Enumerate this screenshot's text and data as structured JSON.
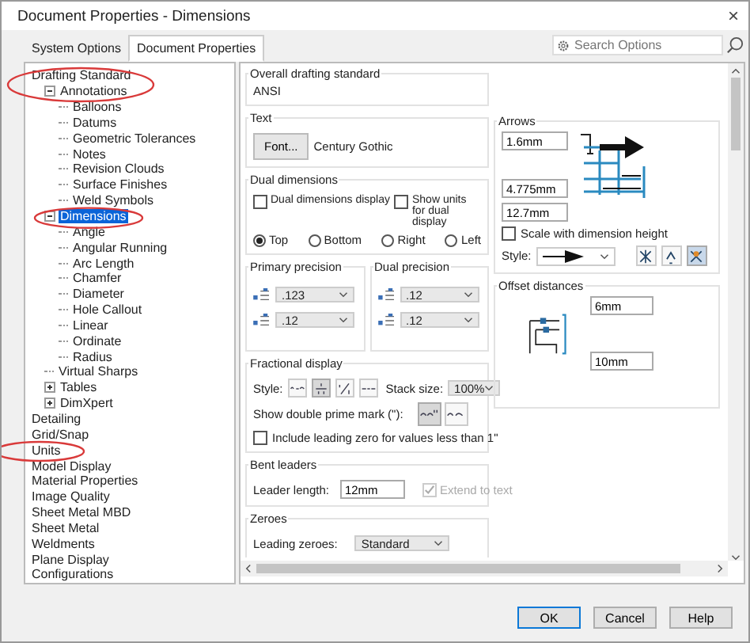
{
  "window": {
    "title": "Document Properties - Dimensions",
    "close": "×"
  },
  "tabs": [
    {
      "label": "System Options",
      "selected": false
    },
    {
      "label": "Document Properties",
      "selected": true
    }
  ],
  "search": {
    "placeholder": "Search Options"
  },
  "tree": [
    {
      "label": "Drafting Standard",
      "selected": false,
      "children": [
        {
          "label": "Annotations",
          "selected": false,
          "expanded": true,
          "children": [
            {
              "label": "Balloons",
              "selected": false
            },
            {
              "label": "Datums",
              "selected": false
            },
            {
              "label": "Geometric Tolerances",
              "selected": false
            },
            {
              "label": "Notes",
              "selected": false
            },
            {
              "label": "Revision Clouds",
              "selected": false
            },
            {
              "label": "Surface Finishes",
              "selected": false
            },
            {
              "label": "Weld Symbols",
              "selected": false
            }
          ]
        },
        {
          "label": "Dimensions",
          "selected": true,
          "expanded": true,
          "children": [
            {
              "label": "Angle",
              "selected": false
            },
            {
              "label": "Angular Running",
              "selected": false
            },
            {
              "label": "Arc Length",
              "selected": false
            },
            {
              "label": "Chamfer",
              "selected": false
            },
            {
              "label": "Diameter",
              "selected": false
            },
            {
              "label": "Hole Callout",
              "selected": false
            },
            {
              "label": "Linear",
              "selected": false
            },
            {
              "label": "Ordinate",
              "selected": false
            },
            {
              "label": "Radius",
              "selected": false
            }
          ]
        },
        {
          "label": "Virtual Sharps",
          "selected": false
        },
        {
          "label": "Tables",
          "selected": false,
          "expanded": false
        },
        {
          "label": "DimXpert",
          "selected": false,
          "expanded": false
        }
      ]
    },
    {
      "label": "Detailing",
      "selected": false
    },
    {
      "label": "Grid/Snap",
      "selected": false
    },
    {
      "label": "Units",
      "selected": false
    },
    {
      "label": "Model Display",
      "selected": false
    },
    {
      "label": "Material Properties",
      "selected": false
    },
    {
      "label": "Image Quality",
      "selected": false
    },
    {
      "label": "Sheet Metal MBD",
      "selected": false
    },
    {
      "label": "Sheet Metal",
      "selected": false
    },
    {
      "label": "Weldments",
      "selected": false
    },
    {
      "label": "Plane Display",
      "selected": false
    },
    {
      "label": "Configurations",
      "selected": false
    }
  ],
  "overall": {
    "title": "Overall drafting standard",
    "value": "ANSI"
  },
  "text_section": {
    "title": "Text",
    "button": "Font...",
    "font": "Century Gothic"
  },
  "dual": {
    "title": "Dual dimensions",
    "checkboxes": [
      {
        "label": "Dual dimensions display",
        "checked": false
      },
      {
        "label": "Show units for dual display",
        "checked": false
      }
    ],
    "positions": [
      {
        "label": "Top",
        "selected": true
      },
      {
        "label": "Bottom",
        "selected": false
      },
      {
        "label": "Right",
        "selected": false
      },
      {
        "label": "Left",
        "selected": false
      }
    ]
  },
  "primary_precision": {
    "title": "Primary precision",
    "values": [
      ".123",
      ".12"
    ]
  },
  "dual_precision": {
    "title": "Dual precision",
    "values": [
      ".12",
      ".12"
    ]
  },
  "fractional": {
    "title": "Fractional display",
    "style_label": "Style:",
    "styles": [
      {
        "kind": "inline",
        "selected": false
      },
      {
        "kind": "stacked",
        "selected": true
      },
      {
        "kind": "diagonal",
        "selected": false
      },
      {
        "kind": "spaced",
        "selected": false
      }
    ],
    "stack_label": "Stack size:",
    "stack_value": "100%",
    "prime_label": "Show double prime mark (\"):",
    "prime_options": [
      {
        "kind": "with-prime",
        "selected": true
      },
      {
        "kind": "plain",
        "selected": false
      }
    ],
    "leading_zero": {
      "label": "Include leading zero for values less than 1\"",
      "checked": false
    }
  },
  "bent": {
    "title": "Bent leaders",
    "length_label": "Leader length:",
    "length_value": "12mm",
    "extend": {
      "label": "Extend to text",
      "checked": true,
      "disabled": true
    }
  },
  "zeroes": {
    "title": "Zeroes",
    "leading_label": "Leading zeroes:",
    "leading_value": "Standard"
  },
  "arrows": {
    "title": "Arrows",
    "sizes": [
      "1.6mm",
      "4.775mm",
      "12.7mm"
    ],
    "scale": {
      "label": "Scale with dimension height",
      "checked": false
    },
    "style_label": "Style:",
    "placements": [
      {
        "kind": "inside",
        "selected": false
      },
      {
        "kind": "outside",
        "selected": false
      },
      {
        "kind": "smart",
        "selected": true
      }
    ]
  },
  "offset": {
    "title": "Offset distances",
    "values": [
      "6mm",
      "10mm"
    ]
  },
  "buttons": [
    {
      "label": "OK",
      "selected": true
    },
    {
      "label": "Cancel",
      "selected": false
    },
    {
      "label": "Help",
      "selected": false
    }
  ]
}
